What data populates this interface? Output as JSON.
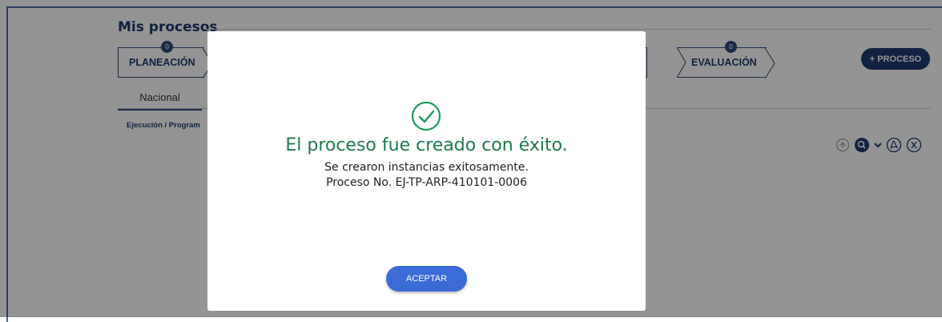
{
  "header": {
    "title": "Mis procesos",
    "add_button": "+ PROCESO"
  },
  "stages": [
    {
      "label": "PLANEACIÓN",
      "count": "0"
    },
    {
      "label": "EVALUACIÓN",
      "count": "0"
    }
  ],
  "tabs": [
    {
      "label": "Nacional",
      "active": true
    }
  ],
  "breadcrumb": "Ejecución / Program",
  "toolbar": {
    "icons": [
      "upload-icon",
      "search-icon",
      "chevron-down-icon",
      "pdf-icon",
      "excel-icon"
    ]
  },
  "modal": {
    "title": "El proceso fue creado con éxito.",
    "line1": "Se crearon instancias exitosamente.",
    "line2": "Proceso No. EJ-TP-ARP-410101-0006",
    "button": "ACEPTAR"
  },
  "colors": {
    "accent": "#1e3a73",
    "success": "#1f7a4c",
    "button": "#3b6bd6"
  }
}
